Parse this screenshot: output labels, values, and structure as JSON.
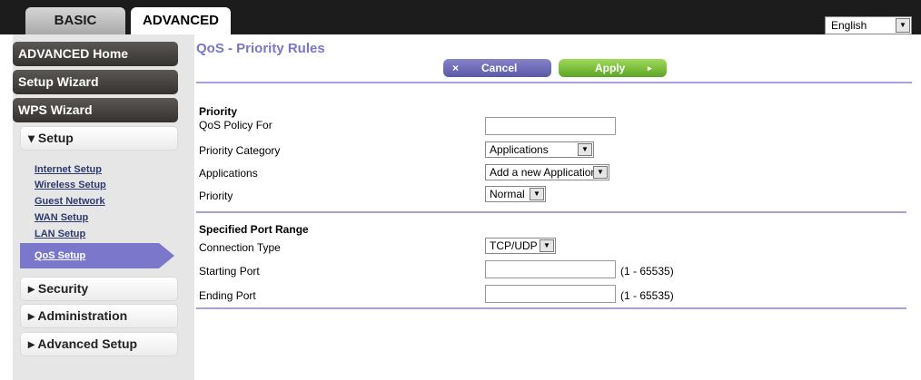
{
  "tabs": {
    "basic": "BASIC",
    "advanced": "ADVANCED"
  },
  "language": {
    "selected": "English",
    "arrow_icon": "dropdown-arrow-icon"
  },
  "sidebar": {
    "advanced_home": "ADVANCED Home",
    "setup_wizard": "Setup Wizard",
    "wps_wizard": "WPS Wizard",
    "setup": "▾ Setup",
    "setup_items": [
      "Internet Setup",
      "Wireless Setup",
      "Guest Network",
      "WAN Setup",
      "LAN Setup"
    ],
    "active_item": "QoS Setup",
    "security": "▸ Security",
    "administration": "▸ Administration",
    "advanced_setup": "▸ Advanced Setup"
  },
  "page": {
    "title": "QoS - Priority Rules",
    "cancel_icon": "×",
    "cancel": "Cancel",
    "apply": "Apply",
    "apply_arrow": "▸"
  },
  "priority": {
    "heading": "Priority",
    "policy_label": "QoS Policy For",
    "policy_value": "",
    "category_label": "Priority Category",
    "category_value": "Applications",
    "applications_label": "Applications",
    "applications_value": "Add a new Application",
    "priority_label": "Priority",
    "priority_value": "Normal"
  },
  "ports": {
    "heading": "Specified Port Range",
    "connection_label": "Connection Type",
    "connection_value": "TCP/UDP",
    "start_label": "Starting Port",
    "start_value": "",
    "start_range": "(1 - 65535)",
    "end_label": "Ending Port",
    "end_value": "",
    "end_range": "(1 - 65535)"
  },
  "colors": {
    "accent": "#7a76c8",
    "cancel_button": "#5b58a8",
    "apply_button": "#5ca524",
    "divider": "#a99fdd"
  }
}
